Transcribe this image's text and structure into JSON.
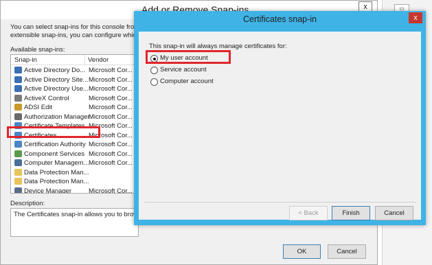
{
  "background_dialog": {
    "title": "Add or Remove Snap-ins",
    "close_glyph": "x",
    "intro_line1": "You can select snap-ins for this console from th",
    "intro_line2": "extensible snap-ins, you can configure which e",
    "available_label": "Available snap-ins:",
    "columns": {
      "snapin": "Snap-in",
      "vendor": "Vendor"
    },
    "snapins": [
      {
        "name": "Active Directory Do...",
        "vendor": "Microsoft Cor...",
        "icon": "ad-domains-icon"
      },
      {
        "name": "Active Directory Site...",
        "vendor": "Microsoft Cor...",
        "icon": "ad-sites-icon"
      },
      {
        "name": "Active Directory Use...",
        "vendor": "Microsoft Cor...",
        "icon": "ad-users-icon"
      },
      {
        "name": "ActiveX Control",
        "vendor": "Microsoft Cor...",
        "icon": "activex-icon"
      },
      {
        "name": "ADSI Edit",
        "vendor": "Microsoft Cor...",
        "icon": "adsi-edit-icon"
      },
      {
        "name": "Authorization Manager",
        "vendor": "Microsoft Cor...",
        "icon": "authorization-icon"
      },
      {
        "name": "Certificate Templates",
        "vendor": "Microsoft Cor...",
        "icon": "certificate-templates-icon"
      },
      {
        "name": "Certificates",
        "vendor": "Microsoft Cor...",
        "icon": "certificates-icon"
      },
      {
        "name": "Certification Authority",
        "vendor": "Microsoft Cor...",
        "icon": "certification-authority-icon"
      },
      {
        "name": "Component Services",
        "vendor": "Microsoft Cor...",
        "icon": "component-services-icon"
      },
      {
        "name": "Computer Managem...",
        "vendor": "Microsoft Cor...",
        "icon": "computer-management-icon"
      },
      {
        "name": "Data Protection Man...",
        "vendor": "",
        "icon": "folder-icon"
      },
      {
        "name": "Data Protection Man...",
        "vendor": "",
        "icon": "folder-icon"
      },
      {
        "name": "Device Manager",
        "vendor": "Microsoft Cor...",
        "icon": "device-manager-icon"
      }
    ],
    "description_label": "Description:",
    "description_text": "The Certificates snap-in allows you to browse",
    "ok_label": "OK",
    "cancel_label": "Cancel"
  },
  "modal": {
    "title": "Certificates snap-in",
    "close_glyph": "x",
    "prompt": "This snap-in will always manage certificates for:",
    "options": [
      {
        "label": "My user account",
        "checked": true
      },
      {
        "label": "Service account",
        "checked": false
      },
      {
        "label": "Computer account",
        "checked": false
      }
    ],
    "back_label": "< Back",
    "finish_label": "Finish",
    "cancel_label": "Cancel"
  },
  "colors": {
    "accent_titlebar": "#3fb3e6",
    "close_button": "#c7372f",
    "highlight": "#e0262b"
  }
}
